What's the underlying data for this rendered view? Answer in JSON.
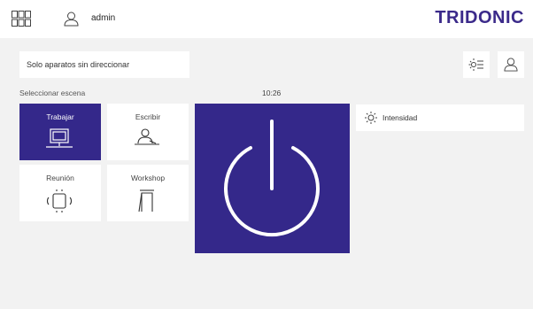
{
  "header": {
    "username": "admin",
    "logo": "TRIDONIC",
    "icons": [
      "app-grid-icon",
      "user-icon"
    ]
  },
  "toolbar": {
    "filter_label": "Solo aparatos sin direccionar",
    "buttons": [
      "light-list-icon",
      "user-icon"
    ]
  },
  "scenes": {
    "label": "Seleccionar escena",
    "items": [
      {
        "label": "Trabajar",
        "icon": "monitor-desk-icon",
        "active": true
      },
      {
        "label": "Escribir",
        "icon": "person-writing-icon",
        "active": false
      },
      {
        "label": "Reunión",
        "icon": "meeting-table-icon",
        "active": false
      },
      {
        "label": "Workshop",
        "icon": "flipchart-icon",
        "active": false
      }
    ]
  },
  "clock": "10:26",
  "power": {
    "icon": "power-icon"
  },
  "intensity": {
    "label": "Intensidad",
    "icon": "sun-icon"
  },
  "colors": {
    "accent": "#34288a",
    "background": "#f2f2f2",
    "logo": "#3b2a8a"
  }
}
